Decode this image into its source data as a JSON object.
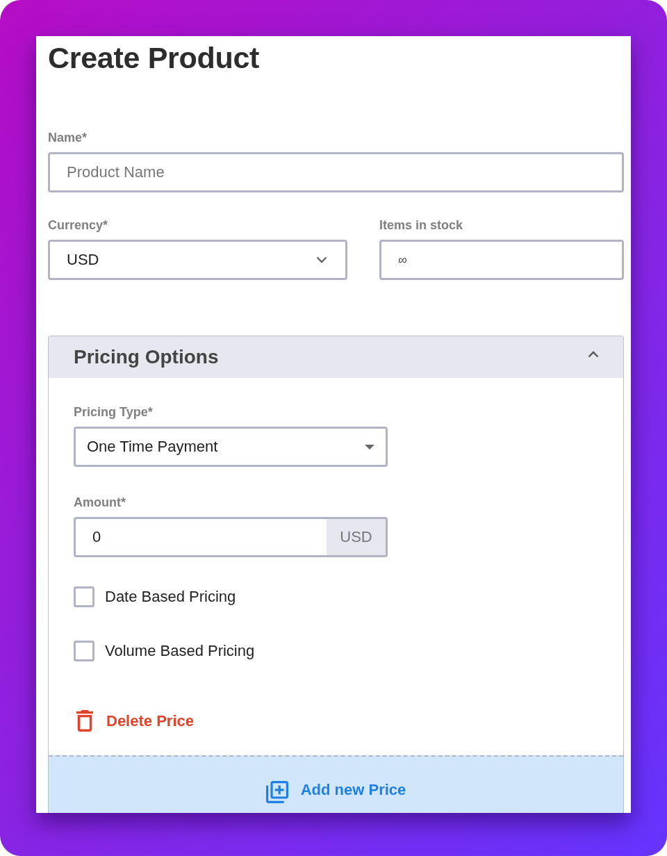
{
  "title": "Create Product",
  "name_field": {
    "label": "Name*",
    "placeholder": "Product Name"
  },
  "currency_field": {
    "label": "Currency*",
    "value": "USD"
  },
  "stock_field": {
    "label": "Items in stock",
    "value": "∞"
  },
  "pricing_panel": {
    "title": "Pricing Options",
    "expanded": true,
    "pricing_type": {
      "label": "Pricing Type*",
      "value": "One Time Payment"
    },
    "amount": {
      "label": "Amount*",
      "value": "0",
      "unit": "USD"
    },
    "options": [
      {
        "label": "Date Based Pricing",
        "checked": false
      },
      {
        "label": "Volume Based Pricing",
        "checked": false
      }
    ],
    "delete_button": "Delete Price",
    "add_button": "Add new Price"
  }
}
